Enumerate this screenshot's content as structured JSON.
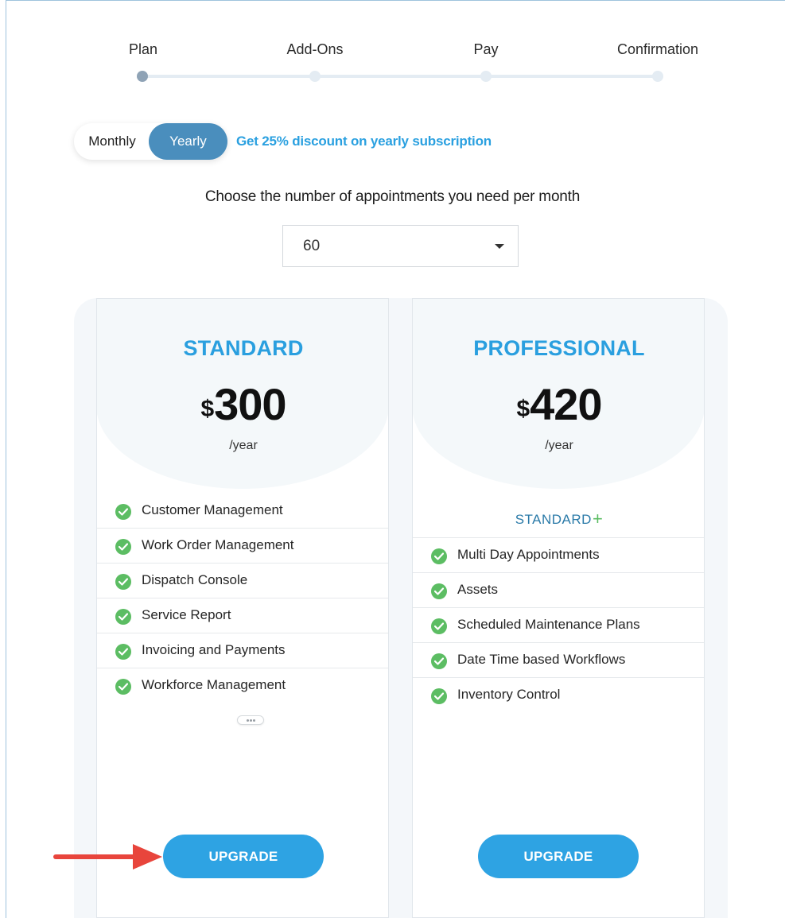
{
  "stepper": {
    "steps": [
      {
        "label": "Plan",
        "active": true
      },
      {
        "label": "Add-Ons",
        "active": false
      },
      {
        "label": "Pay",
        "active": false
      },
      {
        "label": "Confirmation",
        "active": false
      }
    ]
  },
  "billing": {
    "monthly_label": "Monthly",
    "yearly_label": "Yearly",
    "selected": "Yearly",
    "discount_text": "Get 25% discount on yearly subscription"
  },
  "appointments": {
    "prompt": "Choose the number of appointments you need per month",
    "selected_value": "60"
  },
  "plans": {
    "standard": {
      "name": "STANDARD",
      "currency": "$",
      "price": "300",
      "period": "/year",
      "features": [
        "Customer Management",
        "Work Order Management",
        "Dispatch Console",
        "Service Report",
        "Invoicing and Payments",
        "Workforce Management"
      ],
      "cta": "UPGRADE"
    },
    "professional": {
      "name": "PROFESSIONAL",
      "currency": "$",
      "price": "420",
      "period": "/year",
      "includes": "STANDARD",
      "includes_plus": "+",
      "features": [
        "Multi Day Appointments",
        "Assets",
        "Scheduled Maintenance Plans",
        "Date Time based Workflows",
        "Inventory Control"
      ],
      "cta": "UPGRADE"
    }
  },
  "colors": {
    "accent": "#2ea3e3",
    "toggle_active": "#4a8ebd",
    "check_green": "#5cbd63",
    "annotation_arrow": "#e8453c"
  },
  "icons": [
    "check-circle-icon",
    "chevron-down-icon",
    "more-dots-icon",
    "annotation-arrow-icon"
  ]
}
